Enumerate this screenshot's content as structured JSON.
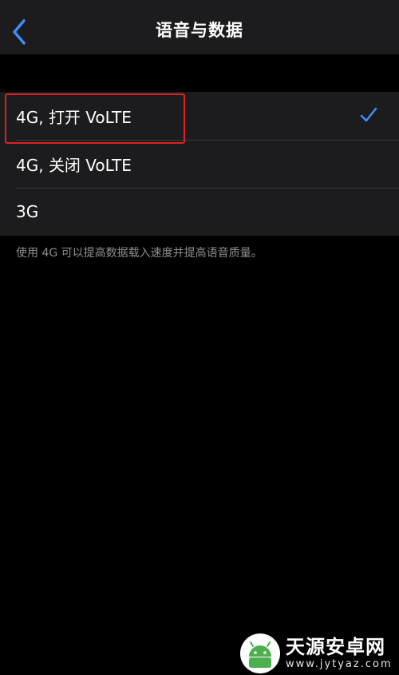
{
  "navbar": {
    "title": "语音与数据",
    "back_icon": "chevron-left-icon"
  },
  "options": [
    {
      "label": "4G, 打开 VoLTE",
      "selected": true
    },
    {
      "label": "4G, 关闭 VoLTE",
      "selected": false
    },
    {
      "label": "3G",
      "selected": false
    }
  ],
  "footer": {
    "note": "使用 4G 可以提高数据载入速度并提高语音质量。"
  },
  "watermark": {
    "brand": "天源安卓网",
    "url": "www.jytyaz.com"
  },
  "colors": {
    "background": "#000000",
    "group_background": "#1c1c1e",
    "accent": "#3e8ef7",
    "highlight": "#e02020",
    "secondary_text": "#8e8e93"
  }
}
